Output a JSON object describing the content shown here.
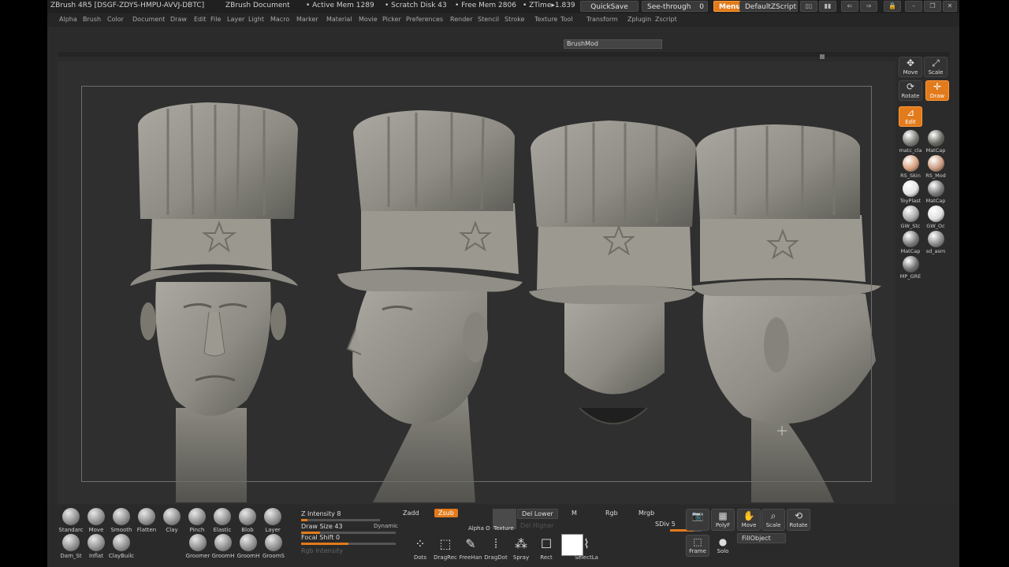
{
  "title": {
    "app": "ZBrush 4R5 [DSGF-ZDYS-HMPU-AVVJ-DBTC]",
    "doc": "ZBrush Document",
    "active_mem": "• Active Mem 1289",
    "scratch": "• Scratch Disk 43",
    "free_mem": "• Free Mem 2806",
    "ztime": "• ZTime▸1.839",
    "quicksave": "QuickSave",
    "see_through": "See-through",
    "see_through_val": "0",
    "menus": "Menus",
    "default_zscript": "DefaultZScript"
  },
  "menu": [
    "Alpha",
    "Brush",
    "Color",
    "Document",
    "Draw",
    "Edit",
    "File",
    "Layer",
    "Light",
    "Macro",
    "Marker",
    "Material",
    "Movie",
    "Picker",
    "Preferences",
    "Render",
    "Stencil",
    "Stroke",
    "Texture",
    "Tool",
    "Transform",
    "Zplugin",
    "Zscript"
  ],
  "brushmod": "BrushMod",
  "shelf": {
    "move": "Move",
    "scale": "Scale",
    "rotate": "Rotate",
    "draw": "Draw",
    "edit": "Edit"
  },
  "materials": [
    {
      "label": "matc_cla",
      "color": "#7d7d77"
    },
    {
      "label": "MatCap",
      "color": "#6a6a62"
    },
    {
      "label": "RS_Skin",
      "color": "#d8a07c"
    },
    {
      "label": "RS_Mod",
      "color": "#c99a7e"
    },
    {
      "label": "ToyPlast",
      "color": "#e2e2e2"
    },
    {
      "label": "MatCap",
      "color": "#7a7a7a"
    },
    {
      "label": "GW_Stc",
      "color": "#a9a9a9"
    },
    {
      "label": "GW_Oc",
      "color": "#dedede"
    },
    {
      "label": "MatCap",
      "color": "#7b7b7b"
    },
    {
      "label": "sd_asm",
      "color": "#8a8a8a"
    },
    {
      "label": "MP_GRE",
      "color": "#6f6f6f"
    }
  ],
  "brushes_row1": [
    "Standarc",
    "Move",
    "Smooth",
    "Flatten",
    "Clay",
    "Pinch",
    "Elastic",
    "Blob",
    "Layer"
  ],
  "brushes_row2": [
    "Dam_St",
    "Inflat",
    "ClayBuilc",
    "Groomer",
    "GroomH",
    "GroomH",
    "GroomS"
  ],
  "sliders": {
    "z_intensity": "Z Intensity 8",
    "z_intensity_val": 0.08,
    "draw_size": "Draw Size 43",
    "draw_size_val": 0.2,
    "dynamic": "Dynamic",
    "focal_shift": "Focal Shift 0",
    "focal_shift_val": 0.5,
    "rgb_intensity": "Rgb Intensity"
  },
  "modes": {
    "zadd": "Zadd",
    "zsub": "Zsub",
    "rgb": "Rgb",
    "mrgb": "Mrgb",
    "m": "M",
    "del_lower": "Del Lower",
    "del_higher": "Del Higher",
    "sdiv": "SDiv 5",
    "alpha": "Alpha O",
    "texture": "Texture"
  },
  "tools": [
    "Dots",
    "DragRec",
    "FreeHan",
    "DragDot",
    "Spray",
    "Rect",
    "SelectLa"
  ],
  "right_tray": {
    "polyf": "PolyF",
    "move": "Move",
    "scale": "Scale",
    "rotate": "Rotate",
    "frame": "Frame",
    "solo": "Solo",
    "fillobject": "FillObject"
  }
}
